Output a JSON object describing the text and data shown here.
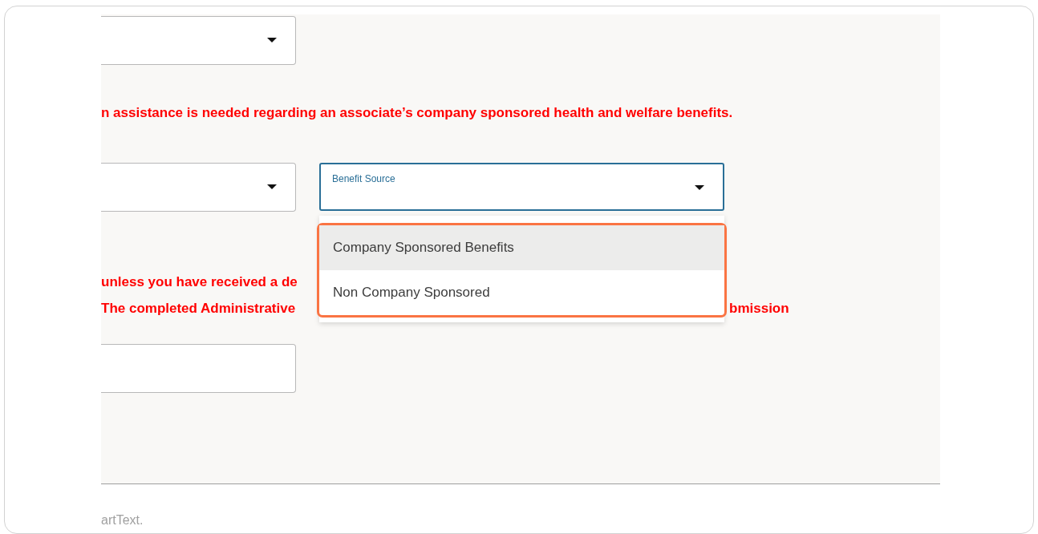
{
  "top_dropdown": {
    "kind": "dropdown"
  },
  "notice": "n assistance is needed regarding an associate’s company sponsored health and welfare benefits.",
  "row": [
    {
      "kind": "dropdown",
      "focused": false
    },
    {
      "kind": "dropdown",
      "label": "Benefit Source",
      "focused": true
    }
  ],
  "menu": {
    "highlighted": true,
    "options": [
      {
        "label": "Company Sponsored Benefits",
        "selected": true
      },
      {
        "label": "Non Company Sponsored",
        "selected": false
      }
    ]
  },
  "warnings": [
    {
      "left": "unless you have received a de"
    },
    {
      "left": "The completed Administrative",
      "right": "bmission"
    }
  ],
  "text_field": {
    "kind": "text"
  },
  "footer": "artText."
}
